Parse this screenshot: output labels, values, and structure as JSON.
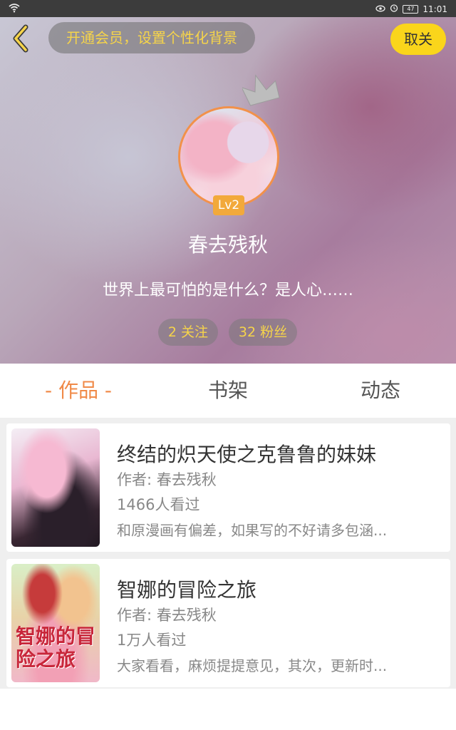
{
  "status_bar": {
    "time": "11:01",
    "battery": "47"
  },
  "header": {
    "vip_prompt": "开通会员，设置个性化背景",
    "unfollow_label": "取关",
    "level": "Lv2",
    "username": "春去残秋",
    "bio": "世界上最可怕的是什么？是人心……",
    "following": "2 关注",
    "fans": "32 粉丝"
  },
  "tabs": {
    "works": "- 作品 -",
    "shelf": "书架",
    "feed": "动态"
  },
  "books": [
    {
      "title": "终结的炽天使之克鲁鲁的妹妹",
      "author": "作者: 春去残秋",
      "views": "1466人看过",
      "desc": "和原漫画有偏差，如果写的不好请多包涵..."
    },
    {
      "title": "智娜的冒险之旅",
      "author": "作者: 春去残秋",
      "views": "1万人看过",
      "desc": "大家看看，麻烦提提意见，其次，更新时...",
      "cover_text": "智娜的冒险之旅"
    }
  ],
  "colors": {
    "accent_orange": "#f08a48",
    "accent_yellow": "#fad51b",
    "stat_text": "#f6d44a"
  }
}
